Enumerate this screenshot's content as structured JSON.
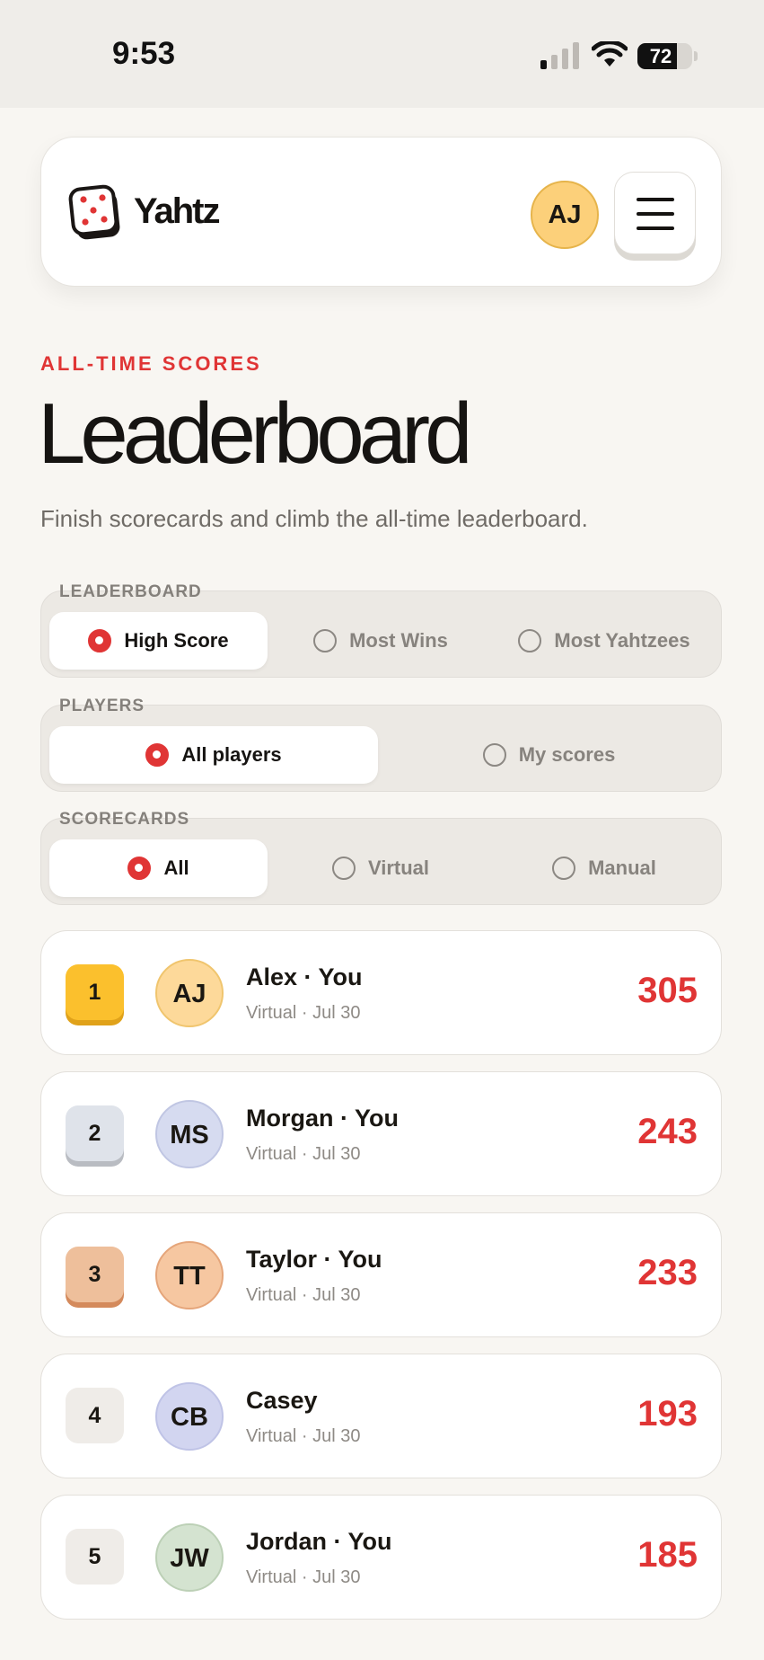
{
  "status_bar": {
    "time": "9:53",
    "battery": "72",
    "battery_level": 0.72
  },
  "header": {
    "logo_text": "Yahtz",
    "logo_icon": "dice-icon",
    "avatar_initials": "AJ",
    "menu_icon": "hamburger-menu-icon"
  },
  "page": {
    "eyebrow": "ALL-TIME SCORES",
    "title": "Leaderboard",
    "subtitle": "Finish scorecards and climb the all-time leaderboard."
  },
  "filters": {
    "leaderboard": {
      "label": "LEADERBOARD",
      "options": [
        "High Score",
        "Most Wins",
        "Most Yahtzees"
      ],
      "selected": "High Score"
    },
    "players": {
      "label": "PLAYERS",
      "options": [
        "All players",
        "My scores"
      ],
      "selected": "All players"
    },
    "scorecards": {
      "label": "SCORECARDS",
      "options": [
        "All",
        "Virtual",
        "Manual"
      ],
      "selected": "All"
    }
  },
  "entries": [
    {
      "rank": "1",
      "initials": "AJ",
      "name": "Alex · You",
      "meta": "Virtual · Jul 30",
      "score": "305"
    },
    {
      "rank": "2",
      "initials": "MS",
      "name": "Morgan · You",
      "meta": "Virtual · Jul 30",
      "score": "243"
    },
    {
      "rank": "3",
      "initials": "TT",
      "name": "Taylor · You",
      "meta": "Virtual · Jul 30",
      "score": "233"
    },
    {
      "rank": "4",
      "initials": "CB",
      "name": "Casey",
      "meta": "Virtual · Jul 30",
      "score": "193"
    },
    {
      "rank": "5",
      "initials": "JW",
      "name": "Jordan · You",
      "meta": "Virtual · Jul 30",
      "score": "185"
    }
  ],
  "colors": {
    "accent": "#e03535",
    "rank_gold": "#fbc02d",
    "rank_silver": "#dfe3ea",
    "rank_bronze": "#eebf9b",
    "rank_default": "#efece8",
    "avatar_aj": "#fdd99a",
    "avatar_ms": "#d6dbf0",
    "avatar_tt": "#f6c7a1",
    "avatar_cb": "#d2d5f0",
    "avatar_jw": "#d4e3d0"
  }
}
